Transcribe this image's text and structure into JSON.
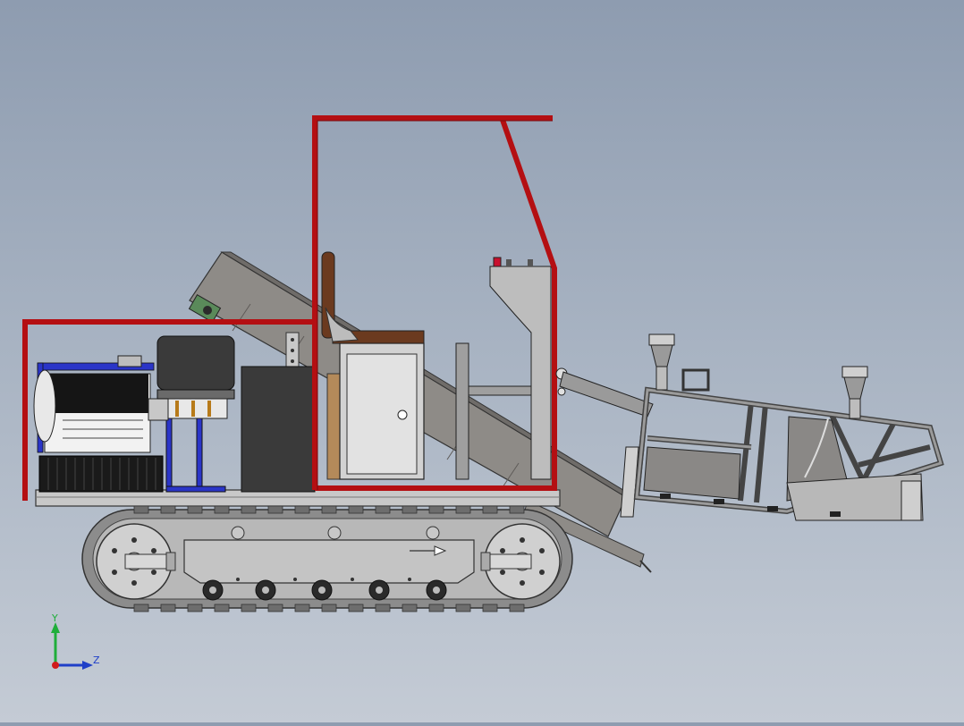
{
  "viewport": {
    "model_name": "",
    "background_top": "#8e9cb0",
    "background_bottom": "#c4cbd5"
  },
  "colors": {
    "frame_red": "#b40f12",
    "frame_red_dark": "#7a0a0c",
    "steel_gray": "#8a8886",
    "steel_light": "#bdbdbd",
    "steel_dark": "#5d5c5b",
    "engine_black": "#1e1e1e",
    "engine_blue": "#2a35c8",
    "seat_brown": "#6b3a1f",
    "door_wood": "#b48a5a",
    "track_gray": "#9a9a9a"
  },
  "triad": {
    "y_label": "Y",
    "z_label": "Z",
    "y_color": "#1fae3a",
    "z_color": "#1f3fc8",
    "origin_color": "#d01c1c"
  },
  "parts": [
    {
      "name": "roll-cage",
      "icon": "frame-icon"
    },
    {
      "name": "engine",
      "icon": "engine-icon"
    },
    {
      "name": "conveyor",
      "icon": "conveyor-icon"
    },
    {
      "name": "cabinet",
      "icon": "cabinet-icon"
    },
    {
      "name": "seat",
      "icon": "seat-icon"
    },
    {
      "name": "crawler-track",
      "icon": "track-icon"
    },
    {
      "name": "harvester-header",
      "icon": "header-icon"
    }
  ]
}
